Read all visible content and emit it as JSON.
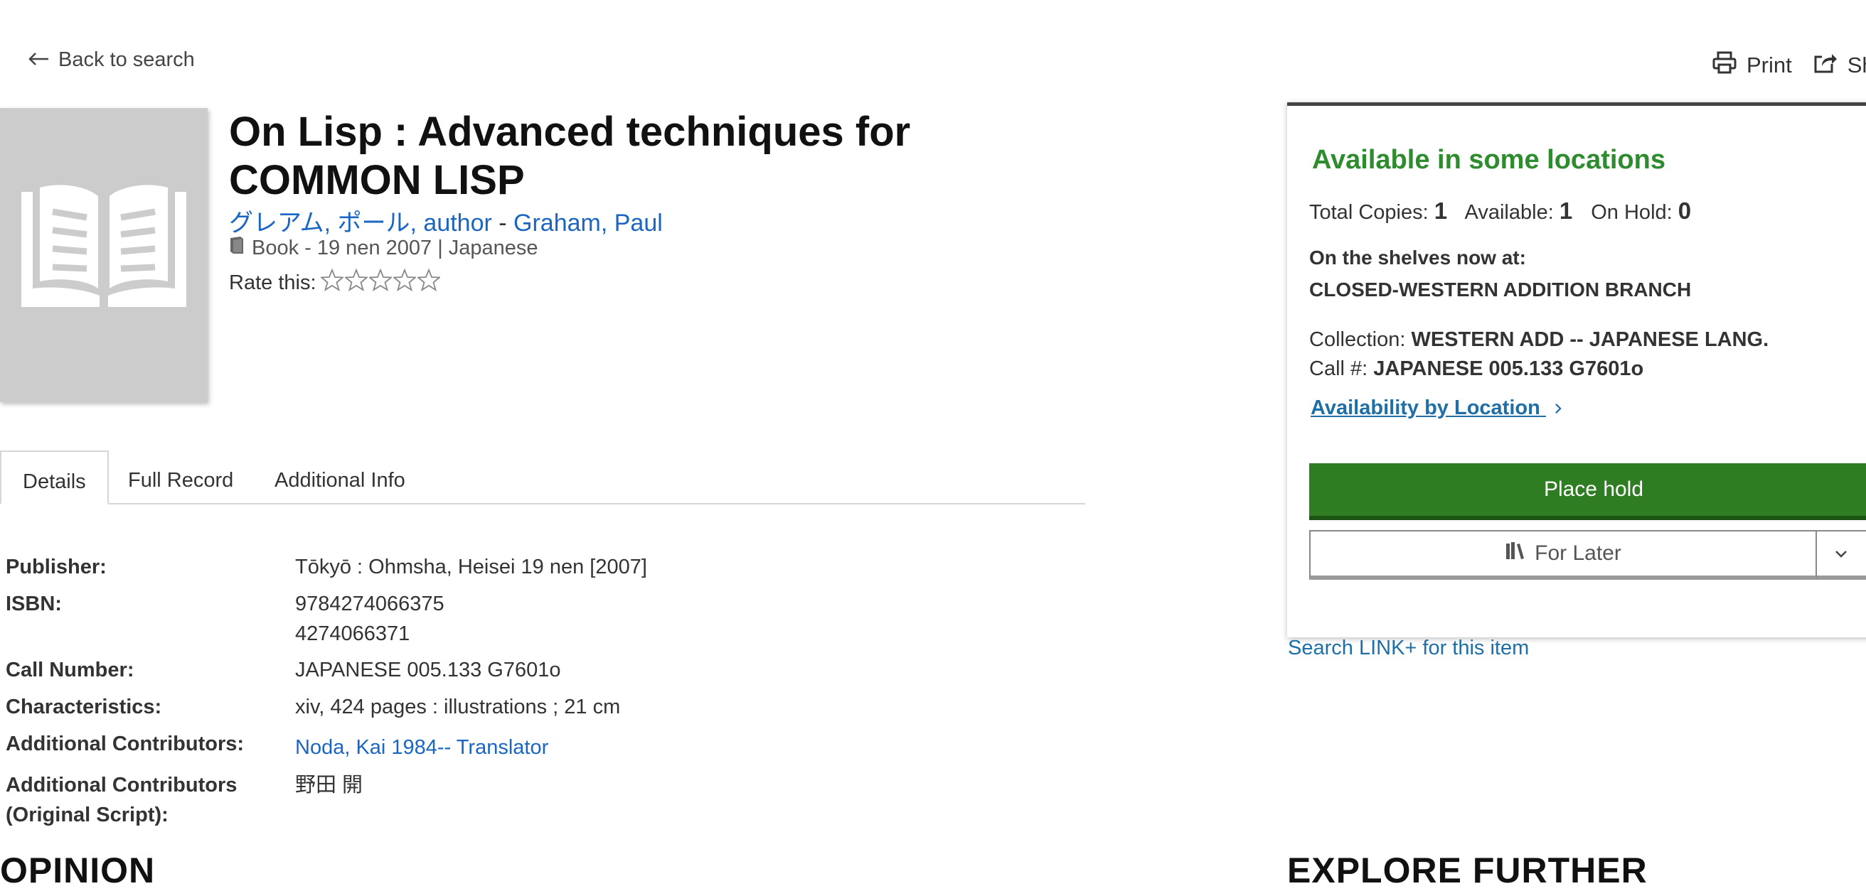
{
  "nav": {
    "back_label": "Back to search"
  },
  "actions": {
    "print_label": "Print",
    "share_label": "Sha"
  },
  "record": {
    "title": "On Lisp : Advanced techniques for COMMON LISP",
    "author_primary": "グレアム, ポール, author",
    "author_separator": " - ",
    "author_secondary": "Graham, Paul",
    "format_line": "Book - 19 nen 2007 | Japanese",
    "rate_label": "Rate this:"
  },
  "tabs": [
    {
      "label": "Details"
    },
    {
      "label": "Full Record"
    },
    {
      "label": "Additional Info"
    }
  ],
  "details": {
    "publisher_label": "Publisher:",
    "publisher": "Tōkyō : Ohmsha, Heisei 19 nen [2007]",
    "isbn_label": "ISBN:",
    "isbn_1": "9784274066375",
    "isbn_2": "4274066371",
    "call_label": "Call Number:",
    "call": "JAPANESE 005.133 G7601o",
    "char_label": "Characteristics:",
    "char": "xiv, 424 pages : illustrations ; 21 cm",
    "contrib_label": "Additional Contributors:",
    "contrib": "Noda, Kai 1984-- Translator",
    "contrib_orig_label_1": "Additional Contributors",
    "contrib_orig_label_2": "(Original Script):",
    "contrib_orig": "野田 開"
  },
  "sections": {
    "opinion": "OPINION",
    "explore": "EXPLORE FURTHER"
  },
  "availability": {
    "title": "Available in some locations",
    "total_label": "Total Copies:",
    "total": "1",
    "available_label": "Available:",
    "available": "1",
    "hold_label": "On Hold:",
    "hold": "0",
    "shelves_label": "On the shelves now at:",
    "shelves_location": "CLOSED-WESTERN ADDITION BRANCH",
    "collection_label": "Collection:",
    "collection": "WESTERN ADD -- JAPANESE LANG.",
    "callno_label": "Call #:",
    "callno": "JAPANESE 005.133 G7601o",
    "by_location_link": "Availability by Location",
    "place_hold": "Place hold",
    "for_later": "For Later",
    "linkplus": "Search LINK+ for this item"
  },
  "colors": {
    "available_green": "#2e8b2e",
    "hold_button": "#2e7d22",
    "link_blue": "#1a66c2"
  },
  "icons": [
    "arrow-left-icon",
    "printer-icon",
    "share-icon",
    "book-cover-placeholder-icon",
    "book-format-icon",
    "star-outline-icon",
    "shelf-icon",
    "chevron-right-icon",
    "chevron-down-icon"
  ]
}
